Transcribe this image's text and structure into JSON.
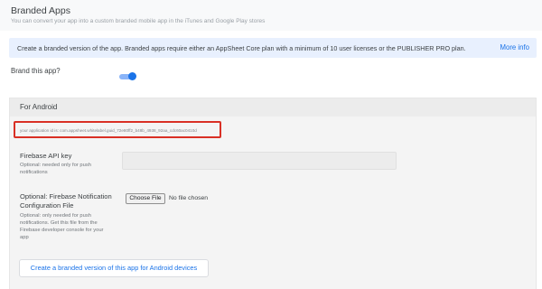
{
  "header": {
    "title": "Branded Apps",
    "subtitle": "You can convert your app into a custom branded mobile app in the iTunes and Google Play stores"
  },
  "banner": {
    "text": "Create a branded version of the app. Branded apps require either an AppSheet Core plan with a minimum of 10 user licenses or the PUBLISHER PRO plan.",
    "link": "More info"
  },
  "brand_toggle": {
    "label": "Brand this app?",
    "enabled": true
  },
  "android": {
    "title": "For Android",
    "application_id": "your application id is: com.appsheet.whitelabel.guid_72e80ff2_b48b_4938_92aa_cdc60ac0410d",
    "api_key": {
      "label": "Firebase API key",
      "help": "Optional: needed only for push notifications",
      "value": ""
    },
    "config_file": {
      "label_line1": "Optional: Firebase Notification",
      "label_line2": "Configuration File",
      "help": "Optional: only needed for push notifications. Get this file from the Firebase developer console for your app",
      "button": "Choose File",
      "status": "No file chosen"
    },
    "create_button": "Create a branded version of this app for Android devices"
  },
  "colors": {
    "accent": "#1a73e8",
    "highlight_border": "#d93025",
    "banner_bg": "#e8f0fe"
  }
}
